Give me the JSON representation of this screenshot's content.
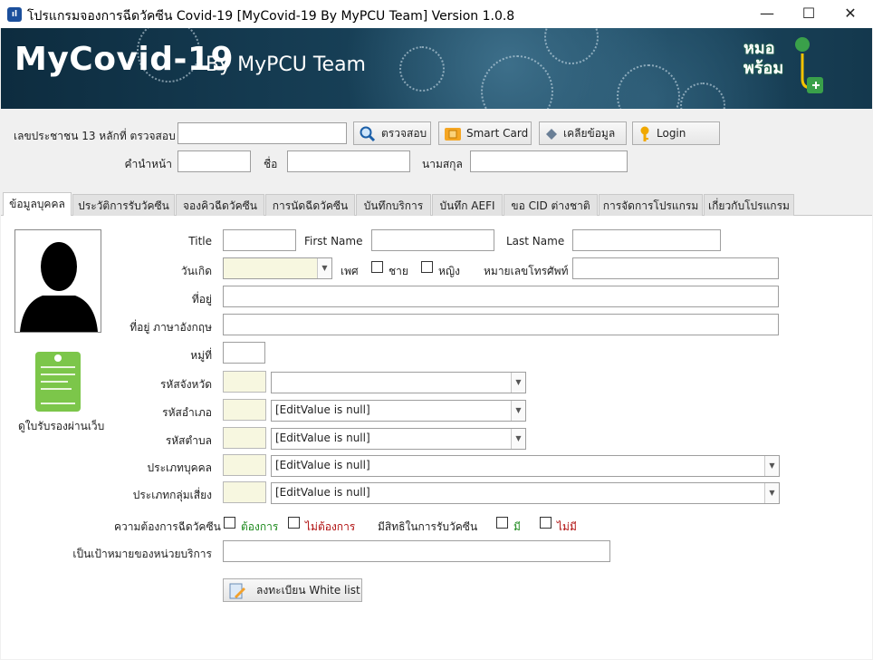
{
  "window": {
    "title": "โปรแกรมจองการฉีดวัคซีน Covid-19 [MyCovid-19 By MyPCU Team]  Version 1.0.8",
    "icon": "app-icon",
    "minimize": "—",
    "maximize": "☐",
    "close": "✕"
  },
  "banner": {
    "title": "MyCovid-19",
    "subtitle": "By MyPCU Team",
    "logo_text": "หมอ พร้อม"
  },
  "search": {
    "cid_label": "เลขประชาชน 13 หลักที่ ตรวจสอบ",
    "cid_value": "",
    "check_button": "ตรวจสอบ",
    "smartcard_button": "Smart Card",
    "clear_button": "เคลียข้อมูล",
    "login_button": "Login",
    "prefix_label": "คำนำหน้า",
    "prefix_value": "",
    "name_label": "ชื่อ",
    "name_value": "",
    "surname_label": "นามสกุล",
    "surname_value": ""
  },
  "tabs": [
    {
      "label": "ข้อมูลบุคคล",
      "active": true
    },
    {
      "label": "ประวัติการรับวัคซีน"
    },
    {
      "label": "จองคิวฉีดวัคซีน"
    },
    {
      "label": "การนัดฉีดวัคซีน"
    },
    {
      "label": "บันทึกบริการ"
    },
    {
      "label": "บันทึก AEFI"
    },
    {
      "label": "ขอ CID ต่างชาติ"
    },
    {
      "label": "การจัดการโปรแกรม"
    },
    {
      "label": "เกี่ยวกับโปรแกรม"
    }
  ],
  "person": {
    "certificate_link": "ดูใบรับรองผ่านเว็บ",
    "title_label": "Title",
    "title_value": "",
    "first_name_label": "First Name",
    "first_name_value": "",
    "last_name_label": "Last Name",
    "last_name_value": "",
    "birthdate_label": "วันเกิด",
    "birthdate_value": "",
    "sex_label": "เพศ",
    "male_label": "ชาย",
    "female_label": "หญิง",
    "phone_label": "หมายเลขโทรศัพท์",
    "phone_value": "",
    "address_label": "ที่อยู่",
    "address_value": "",
    "address_en_label": "ที่อยู่ ภาษาอังกฤษ",
    "address_en_value": "",
    "moo_label": "หมู่ที่",
    "moo_value": "",
    "province_label": "รหัสจังหวัด",
    "province_value": "",
    "district_label": "รหัสอำเภอ",
    "district_value": "[EditValue is null]",
    "subdistrict_label": "รหัสตำบล",
    "subdistrict_value": "[EditValue is null]",
    "person_type_label": "ประเภทบุคคล",
    "person_type_value": "[EditValue is null]",
    "risk_group_label": "ประเภทกลุ่มเสี่ยง",
    "risk_group_value": "[EditValue is null]",
    "need_vaccine_label": "ความต้องการฉีดวัคซีน",
    "want_label": "ต้องการ",
    "not_want_label": "ไม่ต้องการ",
    "right_label": "มีสิทธิในการรับวัคซีน",
    "has_label": "มี",
    "not_has_label": "ไม่มี",
    "target_label": "เป็นเป้าหมายของหน่วยบริการ",
    "target_value": "",
    "whitelist_button": "ลงทะเบียน White list"
  },
  "colors": {
    "want": "#1e8a1e",
    "not_want": "#b01010",
    "accent": "#1b4f9c"
  }
}
